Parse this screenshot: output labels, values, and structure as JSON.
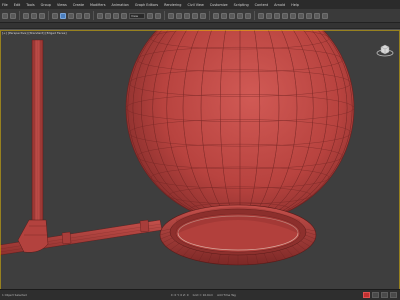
{
  "menu": {
    "items": [
      "File",
      "Edit",
      "Tools",
      "Group",
      "Views",
      "Create",
      "Modifiers",
      "Animation",
      "Graph Editors",
      "Rendering",
      "Civil View",
      "Customize",
      "Scripting",
      "Content",
      "Arnold",
      "Help"
    ]
  },
  "toolbar": {
    "view_dropdown": "View"
  },
  "viewport": {
    "label": "[+] [Perspective] [Standard] [Edged Faces]",
    "object_color": "#b8433f",
    "background_color": "#3e3e3e"
  },
  "status": {
    "left_text": "1 Object Selected",
    "coords": "X: 0 Y: 0 Z: 0",
    "grid": "Grid = 10.0cm",
    "add_time_tag": "Add Time Tag"
  }
}
